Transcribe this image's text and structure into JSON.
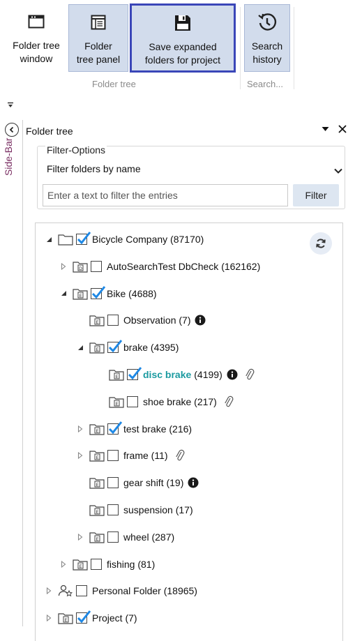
{
  "ribbon": {
    "buttons": [
      {
        "line1": "Folder tree",
        "line2": "window",
        "icon": "window-icon"
      },
      {
        "line1": "Folder",
        "line2": "tree panel",
        "icon": "panel-icon"
      },
      {
        "line1": "Save expanded",
        "line2": "folders for project",
        "icon": "save-icon"
      },
      {
        "line1": "Search",
        "line2": "history",
        "icon": "clock-history-icon"
      }
    ],
    "groups": [
      "Folder tree",
      "Search..."
    ]
  },
  "sidebar": {
    "label": "Side-Bar"
  },
  "panel": {
    "title": "Folder tree",
    "filter": {
      "legend": "Filter-Options",
      "select_value": "Filter folders by name",
      "input_placeholder": "Enter a text to filter the entries",
      "button_label": "Filter"
    },
    "tree": [
      {
        "label": "Bicycle Company (87170)",
        "level": 0,
        "expander": "expanded",
        "icon": "folder-icon",
        "checked": true
      },
      {
        "label": "AutoSearchTest DbCheck (162162)",
        "level": 1,
        "expander": "collapsed",
        "icon": "folder-d-icon",
        "checked": false
      },
      {
        "label": "Bike (4688)",
        "level": 1,
        "expander": "expanded",
        "icon": "folder-e-icon",
        "checked": true
      },
      {
        "label": "Observation (7)",
        "level": 2,
        "expander": "none",
        "icon": "folder-e-icon",
        "checked": false,
        "info": true
      },
      {
        "label": "brake (4395)",
        "level": 2,
        "expander": "expanded",
        "icon": "folder-e-icon",
        "checked": true
      },
      {
        "label": "disc brake",
        "count": "(4199)",
        "level": 3,
        "expander": "none",
        "icon": "folder-e-icon",
        "checked": true,
        "info": true,
        "clip": true,
        "accent": true
      },
      {
        "label": "shoe brake (217)",
        "level": 3,
        "expander": "none",
        "icon": "folder-e-icon",
        "checked": false,
        "clip": true
      },
      {
        "label": "test brake (216)",
        "level": 2,
        "expander": "collapsed",
        "icon": "folder-e-icon",
        "checked": true
      },
      {
        "label": "frame (11)",
        "level": 2,
        "expander": "collapsed",
        "icon": "folder-e-icon",
        "checked": false,
        "clip": true
      },
      {
        "label": "gear shift (19)",
        "level": 2,
        "expander": "none",
        "icon": "folder-e-icon",
        "checked": false,
        "info": true
      },
      {
        "label": "suspension (17)",
        "level": 2,
        "expander": "none",
        "icon": "folder-e-icon",
        "checked": false
      },
      {
        "label": "wheel (287)",
        "level": 2,
        "expander": "collapsed",
        "icon": "folder-e-icon",
        "checked": false
      },
      {
        "label": "fishing (81)",
        "level": 1,
        "expander": "collapsed",
        "icon": "folder-e-icon",
        "checked": false
      },
      {
        "label": "Personal Folder (18965)",
        "level": 0,
        "expander": "collapsed",
        "icon": "person-star-icon",
        "checked": false
      },
      {
        "label": "Project (7)",
        "level": 0,
        "expander": "collapsed",
        "icon": "folder-e-icon",
        "checked": true
      }
    ]
  },
  "colors": {
    "accent": "#1b9aa0",
    "check": "#1e88e5",
    "focus_border": "#3a46b8",
    "selected_bg": "#d2dcec"
  }
}
